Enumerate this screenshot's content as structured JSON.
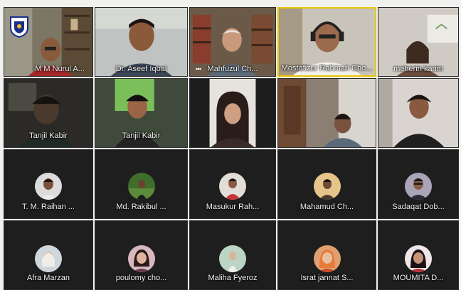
{
  "colors": {
    "background": "#f1f1ef",
    "tile": "#1e1e1e",
    "active_speaker_border": "#e9c600",
    "name_text": "#f2f2f2"
  },
  "rows": [
    {
      "participants": [
        {
          "name": "M M Nurul A...",
          "video": true,
          "speaking": false
        },
        {
          "name": "Dr. Aseef Iqbal",
          "video": true,
          "speaking": false
        },
        {
          "name": "Mahfuzul Ch...",
          "video": true,
          "speaking": false
        },
        {
          "name": "Mostafizur Rahman Cho...",
          "video": true,
          "speaking": false
        },
        {
          "name": "meherin karim",
          "video": true,
          "speaking": false
        }
      ]
    },
    {
      "participants": [
        {
          "name": "Tanjil Kabir",
          "video": true,
          "speaking": false
        },
        {
          "name": "Tanjil Kabir",
          "video": true,
          "speaking": false
        },
        {
          "name": "",
          "video": true,
          "speaking": false
        },
        {
          "name": "",
          "video": true,
          "speaking": false
        },
        {
          "name": "",
          "video": true,
          "speaking": false
        }
      ]
    },
    {
      "participants": [
        {
          "name": "T. M. Raihan ...",
          "video": false,
          "speaking": false
        },
        {
          "name": "Md. Rakibul ...",
          "video": false,
          "speaking": false
        },
        {
          "name": "Masukur Rah...",
          "video": false,
          "speaking": false
        },
        {
          "name": "Mahamud Ch...",
          "video": false,
          "speaking": false
        },
        {
          "name": "Sadaqat Dob...",
          "video": false,
          "speaking": false
        }
      ]
    },
    {
      "participants": [
        {
          "name": "Afra Marzan",
          "video": false,
          "speaking": false
        },
        {
          "name": "poulomy cho...",
          "video": false,
          "speaking": false
        },
        {
          "name": "Maliha Fyeroz",
          "video": false,
          "speaking": false
        },
        {
          "name": "Israt jannat S...",
          "video": false,
          "speaking": false
        },
        {
          "name": "MOUMITA D...",
          "video": false,
          "speaking": false
        }
      ]
    }
  ]
}
